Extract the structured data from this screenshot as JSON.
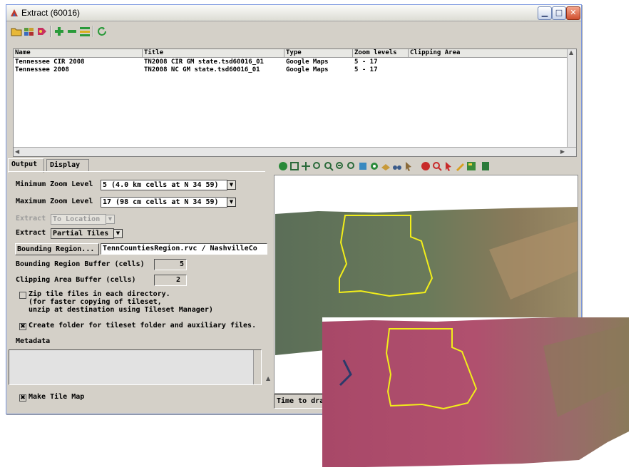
{
  "window": {
    "title": "Extract (60016)",
    "controls": [
      "minimize",
      "maximize",
      "close"
    ]
  },
  "toolbar": {
    "icons": [
      "open-folder-icon",
      "tileset-icon",
      "settings-icon",
      "add-icon",
      "remove-icon",
      "edit-icon",
      "refresh-icon"
    ]
  },
  "layer_list": {
    "columns": [
      "Name",
      "Title",
      "Type",
      "Zoom levels",
      "Clipping Area"
    ],
    "rows": [
      [
        "Tennessee CIR 2008",
        "TN2008 CIR GM state.tsd60016_01",
        "Google Maps",
        "5 - 17",
        ""
      ],
      [
        "Tennessee 2008",
        "TN2008 NC GM state.tsd60016_01",
        "Google Maps",
        "5 - 17",
        ""
      ]
    ]
  },
  "tabs": [
    "Output",
    "Display"
  ],
  "output": {
    "min_zoom_label": "Minimum Zoom Level",
    "min_zoom_value": "5 (4.0 km cells at N 34 59)",
    "max_zoom_label": "Maximum Zoom Level",
    "max_zoom_value": "17 (98 cm cells at N 34 59)",
    "extract_dim_label": "Extract",
    "extract_dim_value": "To Location",
    "extract_label": "Extract",
    "extract_value": "Partial Tiles",
    "bounding_region_button": "Bounding Region...",
    "bounding_region_value": "TennCountiesRegion.rvc / NashvilleCo",
    "bounding_buffer_label": "Bounding Region Buffer (cells)",
    "bounding_buffer_value": "5",
    "clipping_buffer_label": "Clipping Area Buffer (cells)",
    "clipping_buffer_value": "2",
    "zip_label_1": "Zip tile files in each directory.",
    "zip_label_2": "(for faster copying of tileset,",
    "zip_label_3": "unzip at destination using Tileset Manager)",
    "zip_checked": false,
    "create_folder_label": "Create folder for tileset folder and auxiliary files.",
    "create_folder_checked": true,
    "metadata_label": "Metadata",
    "metadata_value": "",
    "make_tile_map_label": "Make Tile Map",
    "make_tile_map_checked": true
  },
  "view": {
    "status_text": "Time to dra",
    "boundary_color": "#f2ee1a",
    "natural_color_hint": "#52684a",
    "cir_color_hint": "#b04a6a"
  }
}
